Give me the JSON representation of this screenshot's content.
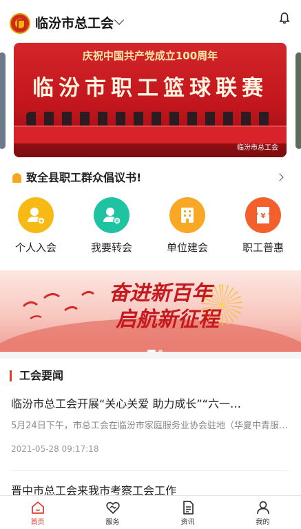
{
  "header": {
    "title": "临汾市总工会"
  },
  "banner": {
    "line1": "庆祝中国共产党成立100周年",
    "line2": "临汾市职工篮球联赛",
    "watermark": "临汾市总工会"
  },
  "notice": {
    "text": "致全县职工群众倡议书!"
  },
  "actions": [
    {
      "label": "个人入会",
      "icon": "person-add-icon",
      "color": "#f7b913"
    },
    {
      "label": "我要转会",
      "icon": "person-transfer-icon",
      "color": "#1fc3a2"
    },
    {
      "label": "单位建会",
      "icon": "building-icon",
      "color": "#f9a825"
    },
    {
      "label": "职工普惠",
      "icon": "voucher-icon",
      "color": "#f4602c"
    }
  ],
  "promo": {
    "line1": "奋进新百年",
    "line2": "启航新征程"
  },
  "news": {
    "section_title": "工会要闻",
    "articles": [
      {
        "title": "临汾市总工会开展“关心关爱 助力成长”“六一…",
        "summary": "5月24日下午，市总工会在临汾市家庭服务业协会驻地（华夏中青服…",
        "date": "2021-05-28 09:17:18"
      },
      {
        "title": "晋中市总工会来我市考察工会工作"
      }
    ]
  },
  "tabbar": {
    "items": [
      {
        "label": "首页",
        "icon": "home-icon",
        "active": true
      },
      {
        "label": "服务",
        "icon": "service-icon",
        "active": false
      },
      {
        "label": "资讯",
        "icon": "news-icon",
        "active": false
      },
      {
        "label": "我的",
        "icon": "profile-icon",
        "active": false
      }
    ]
  },
  "colors": {
    "accent": "#e23a2d",
    "notice_icon": "#f5a623"
  }
}
